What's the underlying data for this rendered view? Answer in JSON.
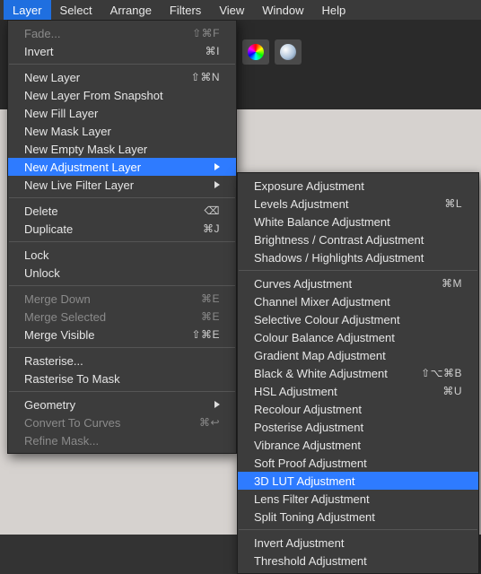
{
  "menubar": {
    "items": [
      {
        "label": "Layer",
        "active": true
      },
      {
        "label": "Select",
        "active": false
      },
      {
        "label": "Arrange",
        "active": false
      },
      {
        "label": "Filters",
        "active": false
      },
      {
        "label": "View",
        "active": false
      },
      {
        "label": "Window",
        "active": false
      },
      {
        "label": "Help",
        "active": false
      }
    ]
  },
  "layer_menu": [
    {
      "type": "item",
      "label": "Fade...",
      "shortcut": "⇧⌘F",
      "enabled": false
    },
    {
      "type": "item",
      "label": "Invert",
      "shortcut": "⌘I",
      "enabled": true
    },
    {
      "type": "sep"
    },
    {
      "type": "item",
      "label": "New Layer",
      "shortcut": "⇧⌘N",
      "enabled": true
    },
    {
      "type": "item",
      "label": "New Layer From Snapshot",
      "enabled": true
    },
    {
      "type": "item",
      "label": "New Fill Layer",
      "enabled": true
    },
    {
      "type": "item",
      "label": "New Mask Layer",
      "enabled": true
    },
    {
      "type": "item",
      "label": "New Empty Mask Layer",
      "enabled": true
    },
    {
      "type": "item",
      "label": "New Adjustment Layer",
      "enabled": true,
      "submenu": true,
      "highlight": true
    },
    {
      "type": "item",
      "label": "New Live Filter Layer",
      "enabled": true,
      "submenu": true
    },
    {
      "type": "sep"
    },
    {
      "type": "item",
      "label": "Delete",
      "shortcut": "⌫",
      "enabled": true
    },
    {
      "type": "item",
      "label": "Duplicate",
      "shortcut": "⌘J",
      "enabled": true
    },
    {
      "type": "sep"
    },
    {
      "type": "item",
      "label": "Lock",
      "enabled": true
    },
    {
      "type": "item",
      "label": "Unlock",
      "enabled": true
    },
    {
      "type": "sep"
    },
    {
      "type": "item",
      "label": "Merge Down",
      "shortcut": "⌘E",
      "enabled": false
    },
    {
      "type": "item",
      "label": "Merge Selected",
      "shortcut": "⌘E",
      "enabled": false
    },
    {
      "type": "item",
      "label": "Merge Visible",
      "shortcut": "⇧⌘E",
      "enabled": true
    },
    {
      "type": "sep"
    },
    {
      "type": "item",
      "label": "Rasterise...",
      "enabled": true
    },
    {
      "type": "item",
      "label": "Rasterise To Mask",
      "enabled": true
    },
    {
      "type": "sep"
    },
    {
      "type": "item",
      "label": "Geometry",
      "enabled": true,
      "submenu": true
    },
    {
      "type": "item",
      "label": "Convert To Curves",
      "shortcut": "⌘↩",
      "enabled": false
    },
    {
      "type": "item",
      "label": "Refine Mask...",
      "enabled": false
    }
  ],
  "adjustment_submenu": [
    {
      "type": "item",
      "label": "Exposure Adjustment",
      "enabled": true
    },
    {
      "type": "item",
      "label": "Levels Adjustment",
      "shortcut": "⌘L",
      "enabled": true
    },
    {
      "type": "item",
      "label": "White Balance Adjustment",
      "enabled": true
    },
    {
      "type": "item",
      "label": "Brightness / Contrast Adjustment",
      "enabled": true
    },
    {
      "type": "item",
      "label": "Shadows / Highlights Adjustment",
      "enabled": true
    },
    {
      "type": "sep"
    },
    {
      "type": "item",
      "label": "Curves Adjustment",
      "shortcut": "⌘M",
      "enabled": true
    },
    {
      "type": "item",
      "label": "Channel Mixer Adjustment",
      "enabled": true
    },
    {
      "type": "item",
      "label": "Selective Colour Adjustment",
      "enabled": true
    },
    {
      "type": "item",
      "label": "Colour Balance Adjustment",
      "enabled": true
    },
    {
      "type": "item",
      "label": "Gradient Map Adjustment",
      "enabled": true
    },
    {
      "type": "item",
      "label": "Black & White Adjustment",
      "shortcut": "⇧⌥⌘B",
      "enabled": true
    },
    {
      "type": "item",
      "label": "HSL Adjustment",
      "shortcut": "⌘U",
      "enabled": true
    },
    {
      "type": "item",
      "label": "Recolour Adjustment",
      "enabled": true
    },
    {
      "type": "item",
      "label": "Posterise Adjustment",
      "enabled": true
    },
    {
      "type": "item",
      "label": "Vibrance Adjustment",
      "enabled": true
    },
    {
      "type": "item",
      "label": "Soft Proof Adjustment",
      "enabled": true
    },
    {
      "type": "item",
      "label": "3D LUT Adjustment",
      "enabled": true,
      "highlight": true
    },
    {
      "type": "item",
      "label": "Lens Filter Adjustment",
      "enabled": true
    },
    {
      "type": "item",
      "label": "Split Toning Adjustment",
      "enabled": true
    },
    {
      "type": "sep"
    },
    {
      "type": "item",
      "label": "Invert Adjustment",
      "enabled": true
    },
    {
      "type": "item",
      "label": "Threshold Adjustment",
      "enabled": true
    }
  ]
}
